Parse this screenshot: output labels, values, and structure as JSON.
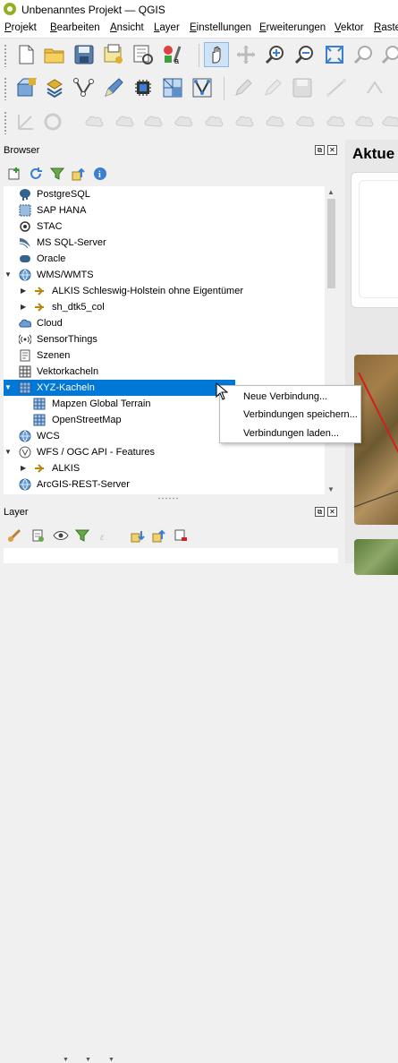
{
  "window": {
    "title": "Unbenanntes Projekt — QGIS"
  },
  "menubar": [
    "Projekt",
    "Bearbeiten",
    "Ansicht",
    "Layer",
    "Einstellungen",
    "Erweiterungen",
    "Vektor",
    "Raste"
  ],
  "browser": {
    "title": "Browser",
    "items": [
      {
        "label": "PostgreSQL",
        "icon": "postgresql-icon",
        "expand": ""
      },
      {
        "label": "SAP HANA",
        "icon": "sap-hana-icon",
        "expand": ""
      },
      {
        "label": "STAC",
        "icon": "stac-icon",
        "expand": ""
      },
      {
        "label": "MS SQL-Server",
        "icon": "mssql-icon",
        "expand": ""
      },
      {
        "label": "Oracle",
        "icon": "oracle-icon",
        "expand": ""
      },
      {
        "label": "WMS/WMTS",
        "icon": "wms-icon",
        "expand": "▼"
      },
      {
        "label": "ALKIS Schleswig-Holstein ohne Eigentümer",
        "icon": "wms-connection-icon",
        "expand": "▶"
      },
      {
        "label": "sh_dtk5_col",
        "icon": "wms-connection-icon",
        "expand": "▶"
      },
      {
        "label": "Cloud",
        "icon": "cloud-icon",
        "expand": ""
      },
      {
        "label": "SensorThings",
        "icon": "sensorthings-icon",
        "expand": ""
      },
      {
        "label": "Szenen",
        "icon": "scenes-icon",
        "expand": ""
      },
      {
        "label": "Vektorkacheln",
        "icon": "vector-tiles-icon",
        "expand": ""
      },
      {
        "label": "XYZ-Kacheln",
        "icon": "xyz-tiles-icon",
        "expand": "▼"
      },
      {
        "label": "Mapzen Global Terrain",
        "icon": "tile-grid-icon",
        "expand": ""
      },
      {
        "label": "OpenStreetMap",
        "icon": "tile-grid-icon",
        "expand": ""
      },
      {
        "label": "WCS",
        "icon": "wcs-icon",
        "expand": ""
      },
      {
        "label": "WFS / OGC API - Features",
        "icon": "wfs-icon",
        "expand": "▼"
      },
      {
        "label": "ALKIS",
        "icon": "wfs-connection-icon",
        "expand": "▶"
      },
      {
        "label": "ArcGIS-REST-Server",
        "icon": "arcgis-icon",
        "expand": ""
      }
    ]
  },
  "context_menu": [
    "Neue Verbindung...",
    "Verbindungen speichern...",
    "Verbindungen laden..."
  ],
  "layer_panel": {
    "title": "Layer"
  },
  "right_panel": {
    "title": "Aktue"
  },
  "colors": {
    "selection": "#0078d7",
    "qgis_green": "#93b023"
  }
}
